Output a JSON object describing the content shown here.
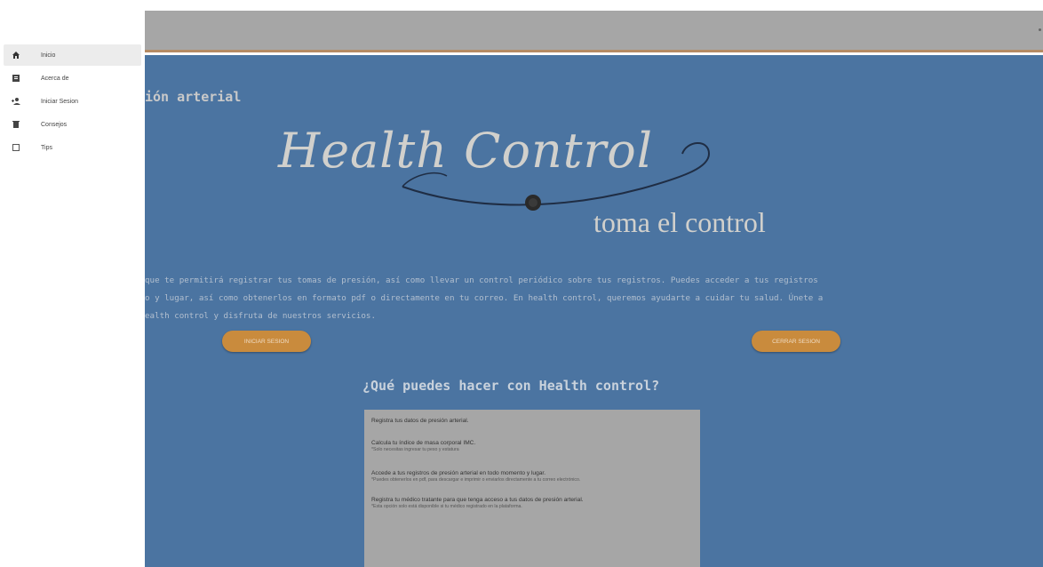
{
  "sidebar": {
    "items": [
      {
        "label": "Inicio",
        "icon": "home-icon"
      },
      {
        "label": "Acerca de",
        "icon": "info-icon"
      },
      {
        "label": "Iniciar Sesion",
        "icon": "login-icon"
      },
      {
        "label": "Consejos",
        "icon": "tips-icon"
      },
      {
        "label": "Tips",
        "icon": "bookmark-icon"
      }
    ]
  },
  "main": {
    "title": "ión arterial",
    "logo": {
      "text": "Health Control",
      "tagline": "toma el control"
    },
    "intro": [
      "que te permitirá registrar tus tomas de presión, así como llevar un control periódico sobre tus registros. Puedes acceder a tus registros",
      "o y lugar, así como obtenerlos en formato pdf o directamente en tu correo. En health control, queremos ayudarte a cuidar tu salud. Únete a",
      "ealth control y disfruta de nuestros servicios."
    ],
    "register_button": "INICIAR SESION",
    "login_button": "CERRAR SESION",
    "section_title": "¿Qué puedes hacer con Health control?",
    "features": [
      {
        "title": "Registra tus datos de presión arterial.",
        "note": ""
      },
      {
        "title": "Calcula tu índice de masa corporal IMC.",
        "note": "*Solo necesitas ingresar tu peso y estatura"
      },
      {
        "title": "Accede a tus registros de presión arterial en todo momento y lugar.",
        "note": "*Puedes obtenerlos en pdf, para descargar e imprimir o enviarlos directamente a tu correo electrónico."
      },
      {
        "title": "Registra tu médico tratante para que tenga acceso a tus datos de presión arterial.",
        "note": "*Esta opción solo está disponible si tu médico registrado en la plataforma."
      }
    ]
  },
  "colors": {
    "main_bg": "#4b74a1",
    "toolbar": "#a6a6a6",
    "accent": "#c98b3d",
    "panel": "#a6a6a6"
  }
}
